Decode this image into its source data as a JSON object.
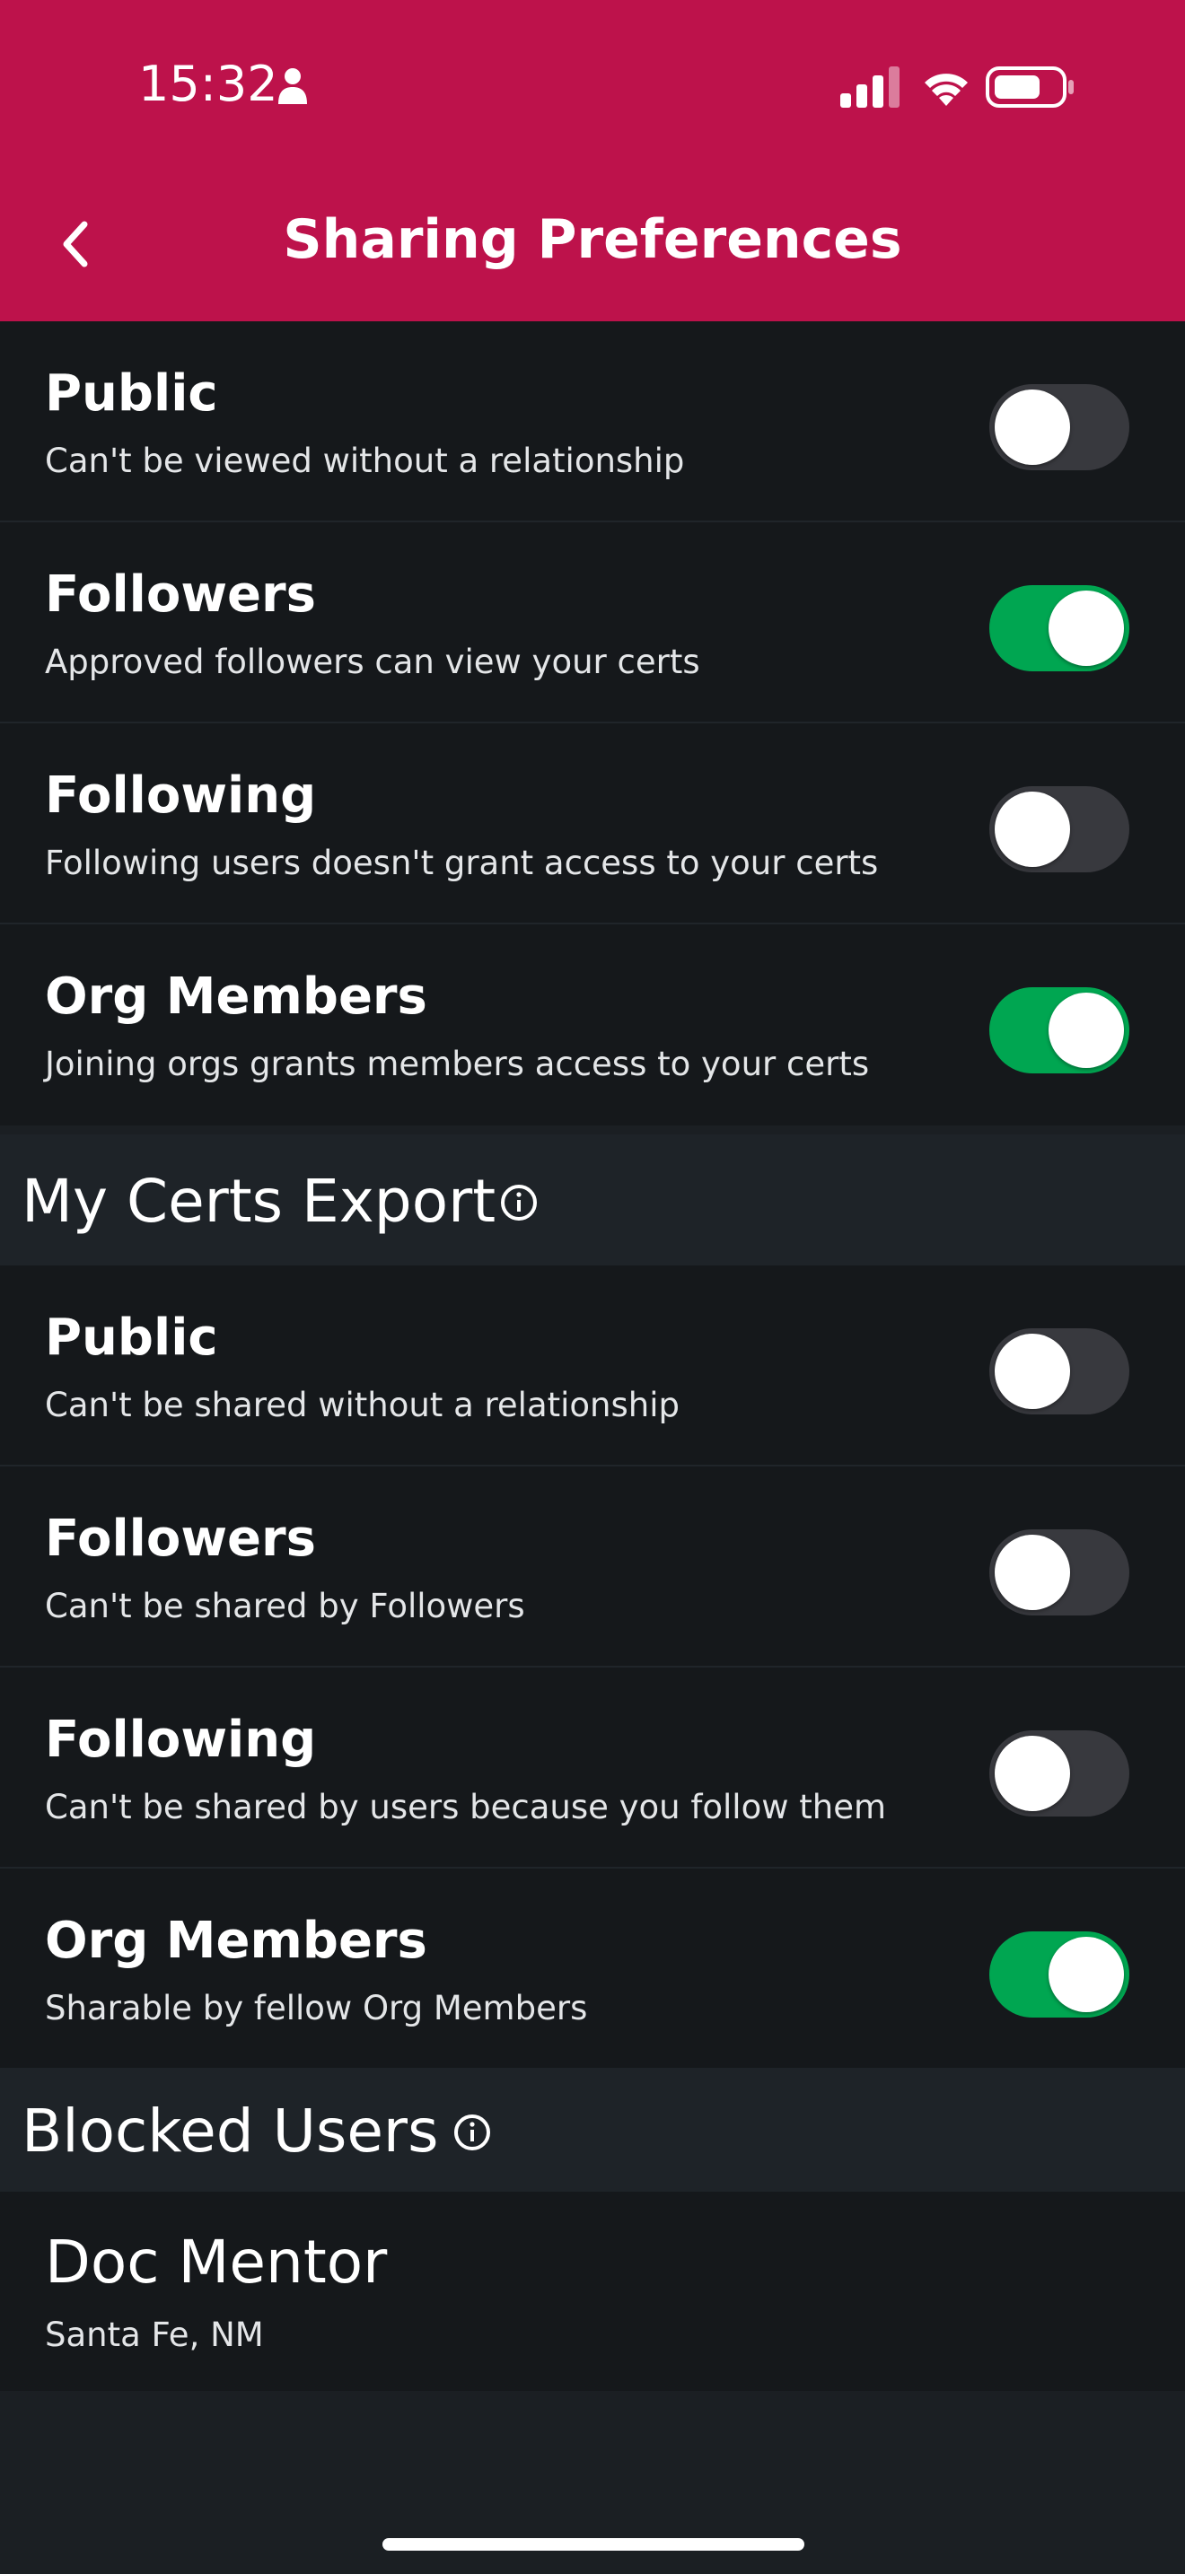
{
  "status_bar": {
    "time": "15:32",
    "icons": [
      "person-icon",
      "cellular-signal-icon",
      "wifi-icon",
      "battery-icon"
    ]
  },
  "header": {
    "title": "Sharing Preferences",
    "back_icon": "chevron-left-icon",
    "background": "#bd124b"
  },
  "view_sharing": {
    "items": [
      {
        "title": "Public",
        "subtitle": "Can't be viewed without a relationship",
        "on": false
      },
      {
        "title": "Followers",
        "subtitle": "Approved followers can view your certs",
        "on": true
      },
      {
        "title": "Following",
        "subtitle": "Following users doesn't grant access to your certs",
        "on": false
      },
      {
        "title": "Org Members",
        "subtitle": "Joining orgs grants members access to your certs",
        "on": true
      }
    ]
  },
  "export": {
    "title": "My Certs Export",
    "icon": "info-circle-icon",
    "items": [
      {
        "title": "Public",
        "subtitle": "Can't be shared without a relationship",
        "on": false
      },
      {
        "title": "Followers",
        "subtitle": "Can't be shared by Followers",
        "on": false
      },
      {
        "title": "Following",
        "subtitle": "Can't be shared by users because you follow them",
        "on": false
      },
      {
        "title": "Org Members",
        "subtitle": "Sharable by fellow Org Members",
        "on": true
      }
    ]
  },
  "blocked": {
    "title": "Blocked Users",
    "icon": "info-circle-icon",
    "users": [
      {
        "name": "Doc Mentor",
        "location": "Santa Fe, NM"
      }
    ]
  },
  "colors": {
    "accent": "#bd124b",
    "toggle_on": "#00a651",
    "toggle_off": "#38393e",
    "background": "#1b1f23",
    "row_background": "#15181b"
  }
}
